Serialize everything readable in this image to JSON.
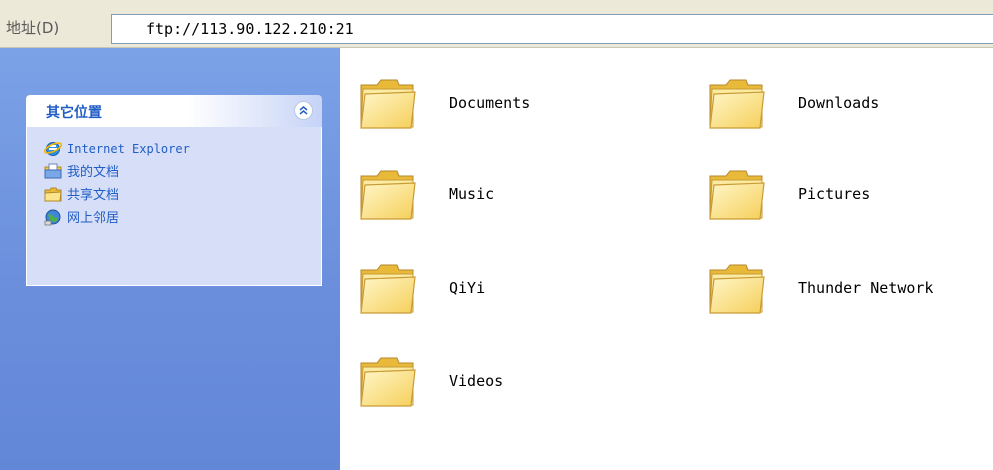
{
  "address_bar": {
    "label": "地址(D)",
    "value": "ftp://113.90.122.210:21"
  },
  "other_places": {
    "title": "其它位置",
    "items": [
      {
        "label": "Internet Explorer",
        "icon": "internet-explorer-icon"
      },
      {
        "label": "我的文档",
        "icon": "my-documents-icon"
      },
      {
        "label": "共享文档",
        "icon": "shared-documents-icon"
      },
      {
        "label": "网上邻居",
        "icon": "network-places-icon"
      }
    ]
  },
  "folders": [
    {
      "name": "Documents"
    },
    {
      "name": "Downloads"
    },
    {
      "name": "Music"
    },
    {
      "name": "Pictures"
    },
    {
      "name": "QiYi"
    },
    {
      "name": "Thunder Network"
    },
    {
      "name": "Videos"
    }
  ],
  "colors": {
    "task_pane_bg": "#7ba2e7",
    "task_link": "#215dc6",
    "folder_yellow": "#f7d66b"
  }
}
